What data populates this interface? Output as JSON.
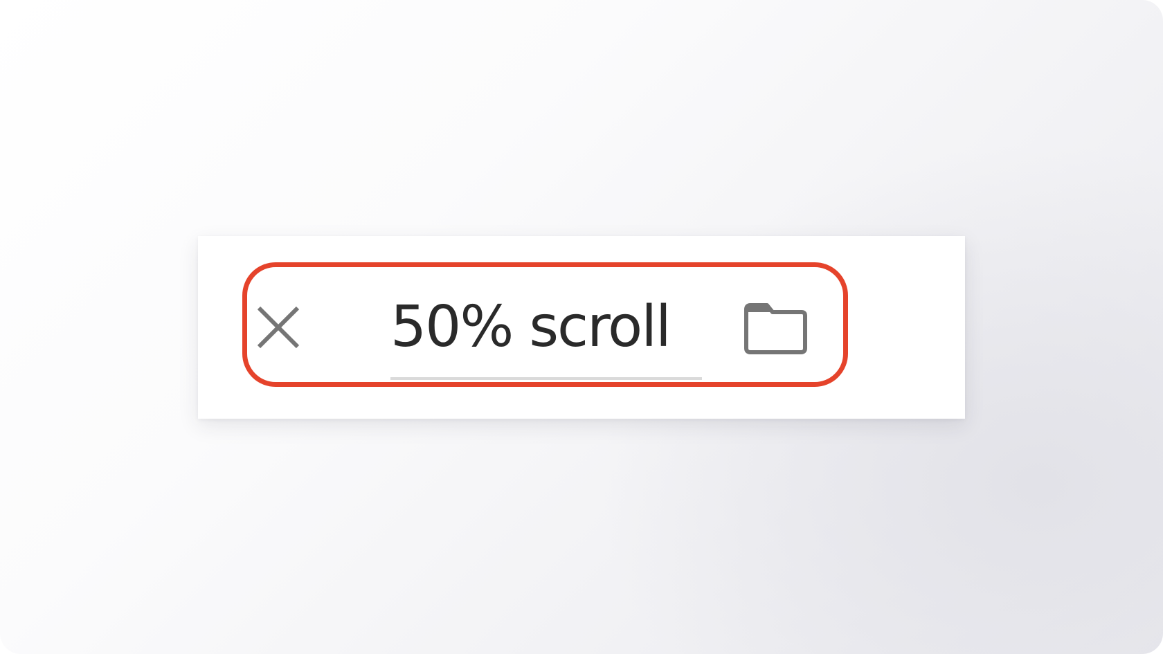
{
  "input": {
    "value": "50% scroll"
  },
  "icons": {
    "close": "close-icon",
    "folder": "folder-icon"
  },
  "colors": {
    "highlight": "#e5432b",
    "icon": "#757575",
    "text": "#2a2a2a",
    "underline": "#dadada"
  }
}
